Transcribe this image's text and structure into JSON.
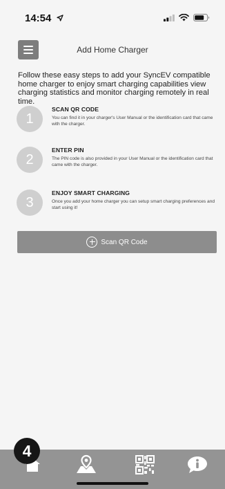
{
  "status_bar": {
    "time": "14:54"
  },
  "header": {
    "title": "Add Home Charger"
  },
  "intro": "Follow these easy steps to add your SyncEV compatible home charger to enjoy smart charging capabilities view charging statistics and monitor charging remotely in real time.",
  "steps": [
    {
      "number": "1",
      "title": "SCAN QR CODE",
      "description": "You can find it in your charger's User Manual or the identification card that came with the charger."
    },
    {
      "number": "2",
      "title": "ENTER PIN",
      "description": "The PIN code is also provided in your User Manual or the identification card that came with the charger."
    },
    {
      "number": "3",
      "title": "ENJOY SMART CHARGING",
      "description": "Once you add your home charger you can setup smart charging preferences and start using it!"
    }
  ],
  "scan_button": {
    "label": "Scan QR Code",
    "icon": "plus-circle-icon"
  },
  "tab_bar": {
    "tabs": [
      {
        "icon": "home-icon"
      },
      {
        "icon": "map-pin-icon"
      },
      {
        "icon": "qr-code-icon"
      },
      {
        "icon": "info-icon"
      }
    ]
  },
  "badge": {
    "label": "4"
  },
  "colors": {
    "button": "#8d8d8d",
    "tab_bar": "#949494",
    "step_circle": "#cfcfcf",
    "menu_button": "#7d7d7d"
  }
}
